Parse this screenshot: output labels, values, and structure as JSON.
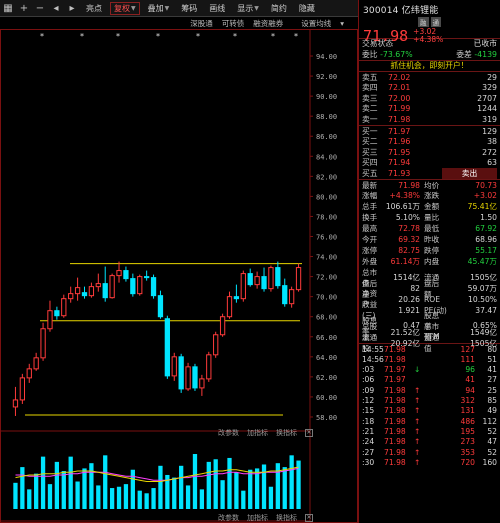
{
  "toolbar": {
    "icons": [
      "grid-icon",
      "plus-icon",
      "minus-icon",
      "arrow-left-icon",
      "arrow-right-icon"
    ],
    "buttons": [
      {
        "label": "亮点",
        "active": false,
        "arrow": false
      },
      {
        "label": "复权",
        "active": true,
        "arrow": true
      },
      {
        "label": "叠加",
        "active": false,
        "arrow": true
      },
      {
        "label": "筹码",
        "active": false,
        "arrow": false
      },
      {
        "label": "画线",
        "active": false,
        "arrow": false
      },
      {
        "label": "显示",
        "active": false,
        "arrow": true
      },
      {
        "label": "简约",
        "active": false,
        "arrow": false
      },
      {
        "label": "隐藏",
        "active": false,
        "arrow": false
      }
    ],
    "sub_items": [
      "深股通",
      "可转债",
      "融资融券",
      "设置均线"
    ],
    "sub_arrow": "▾"
  },
  "main_chart": {
    "y_ticks": [
      "94.00",
      "92.00",
      "90.00",
      "88.00",
      "86.00",
      "84.00",
      "82.00",
      "80.00",
      "78.00",
      "76.00",
      "74.00",
      "72.00",
      "70.00",
      "68.00",
      "66.00",
      "64.00",
      "62.00",
      "60.00",
      "58.00"
    ],
    "ylim": [
      57,
      95
    ],
    "upper_line": 73.3,
    "mid_line": 67.6,
    "lower_line": 58.2,
    "candles": [
      [
        59.0,
        61.0,
        58.1,
        59.7
      ],
      [
        59.7,
        62.3,
        59.3,
        61.9
      ],
      [
        61.9,
        63.3,
        61.4,
        62.8
      ],
      [
        62.8,
        64.4,
        62.6,
        63.9
      ],
      [
        63.9,
        67.4,
        63.6,
        66.8
      ],
      [
        66.8,
        69.6,
        66.5,
        68.6
      ],
      [
        68.6,
        69.0,
        67.7,
        68.1
      ],
      [
        68.1,
        70.2,
        67.9,
        69.8
      ],
      [
        69.8,
        71.0,
        69.4,
        70.3
      ],
      [
        70.3,
        71.9,
        69.6,
        70.9
      ],
      [
        70.4,
        71.0,
        69.8,
        70.1
      ],
      [
        70.1,
        71.4,
        69.9,
        71.0
      ],
      [
        71.0,
        72.3,
        70.5,
        71.3
      ],
      [
        71.3,
        73.0,
        69.5,
        69.9
      ],
      [
        69.9,
        72.3,
        69.8,
        72.1
      ],
      [
        72.1,
        73.5,
        71.4,
        72.6
      ],
      [
        72.6,
        73.0,
        71.5,
        71.8
      ],
      [
        71.8,
        72.3,
        70.0,
        70.3
      ],
      [
        70.3,
        72.2,
        70.1,
        72.0
      ],
      [
        72.0,
        72.6,
        71.6,
        71.9
      ],
      [
        71.9,
        72.2,
        69.8,
        70.1
      ],
      [
        70.1,
        70.6,
        67.8,
        68.0
      ],
      [
        67.8,
        68.1,
        61.8,
        62.1
      ],
      [
        62.1,
        64.4,
        61.6,
        64.0
      ],
      [
        64.0,
        64.3,
        60.4,
        60.8
      ],
      [
        60.8,
        63.4,
        60.6,
        63.0
      ],
      [
        63.0,
        63.3,
        60.6,
        60.9
      ],
      [
        60.9,
        62.2,
        60.1,
        61.8
      ],
      [
        61.8,
        64.5,
        61.5,
        64.2
      ],
      [
        64.2,
        66.5,
        63.9,
        66.2
      ],
      [
        66.2,
        68.3,
        66.0,
        68.0
      ],
      [
        68.0,
        70.5,
        67.8,
        70.0
      ],
      [
        70.0,
        71.2,
        69.4,
        69.8
      ],
      [
        69.8,
        72.6,
        69.5,
        72.3
      ],
      [
        72.3,
        72.8,
        71.0,
        71.2
      ],
      [
        71.2,
        72.5,
        70.8,
        72.0
      ],
      [
        72.0,
        72.9,
        70.5,
        70.8
      ],
      [
        70.8,
        73.1,
        70.5,
        72.9
      ],
      [
        72.9,
        73.5,
        70.8,
        71.1
      ],
      [
        71.1,
        71.8,
        69.0,
        69.3
      ],
      [
        69.3,
        71.0,
        68.9,
        70.7
      ],
      [
        70.7,
        73.3,
        70.5,
        72.9
      ]
    ]
  },
  "indicator1": {
    "tabs": [
      "改参数",
      "加指标",
      "换指标"
    ],
    "bars": [
      2.0,
      3.2,
      1.5,
      2.7,
      4.0,
      1.9,
      3.6,
      2.9,
      4.0,
      2.1,
      3.1,
      3.5,
      1.8,
      4.1,
      1.6,
      1.7,
      1.9,
      3.0,
      1.4,
      1.2,
      1.6,
      3.3,
      2.6,
      2.4,
      3.3,
      1.8,
      4.2,
      1.5,
      3.6,
      3.8,
      2.2,
      3.9,
      2.8,
      1.4,
      3.0,
      3.1,
      3.4,
      1.7,
      3.5,
      3.2,
      4.1,
      3.7
    ],
    "line1": [
      2.6,
      2.6,
      2.5,
      2.5,
      2.5,
      2.5,
      2.6,
      2.6,
      2.7,
      2.7,
      2.8,
      2.8,
      2.8,
      2.8,
      2.7,
      2.6,
      2.5,
      2.5,
      2.4,
      2.3,
      2.2,
      2.2,
      2.2,
      2.3,
      2.4,
      2.4,
      2.5,
      2.5,
      2.6,
      2.7,
      2.7,
      2.8,
      2.8,
      2.7,
      2.7,
      2.7,
      2.8,
      2.8,
      2.8,
      2.9,
      3.0,
      3.1
    ],
    "line2": [
      2.4,
      2.5,
      2.6,
      2.6,
      2.7,
      2.7,
      2.7,
      2.8,
      2.8,
      2.9,
      2.9,
      2.9,
      2.8,
      2.7,
      2.6,
      2.5,
      2.4,
      2.3,
      2.2,
      2.1,
      2.1,
      2.1,
      2.2,
      2.3,
      2.4,
      2.5,
      2.6,
      2.7,
      2.8,
      2.9,
      2.9,
      3.0,
      3.0,
      2.9,
      2.8,
      2.8,
      2.8,
      2.9,
      2.9,
      3.0,
      3.1,
      3.2
    ],
    "ylim": [
      0,
      5.5
    ]
  },
  "indicator2": {
    "tabs": [
      "改参数",
      "加指标",
      "换指标"
    ]
  },
  "quote": {
    "code_name": "300014 亿纬锂能",
    "badges": [
      "融",
      "通"
    ],
    "price": "71.98",
    "change": "+3.02",
    "change_pct": "+4.38%",
    "status_label": "交易状态",
    "status_value": "已收市",
    "wei_bi_label": "委比",
    "wei_bi_value": "-73.67%",
    "wei_cha_label": "委差",
    "wei_cha_value": "-4139",
    "promo": "抓住机会，即刻开户！",
    "asks": [
      {
        "label": "卖五",
        "price": "72.02",
        "vol": "29"
      },
      {
        "label": "卖四",
        "price": "72.01",
        "vol": "329"
      },
      {
        "label": "卖三",
        "price": "72.00",
        "vol": "2707"
      },
      {
        "label": "卖二",
        "price": "71.99",
        "vol": "1244"
      },
      {
        "label": "卖一",
        "price": "71.98",
        "vol": "319"
      }
    ],
    "bids": [
      {
        "label": "买一",
        "price": "71.97",
        "vol": "129"
      },
      {
        "label": "买二",
        "price": "71.96",
        "vol": "38"
      },
      {
        "label": "买三",
        "price": "71.95",
        "vol": "272"
      },
      {
        "label": "买四",
        "price": "71.94",
        "vol": "63"
      },
      {
        "label": "买五",
        "price": "71.93",
        "vol": "卖出"
      }
    ],
    "stats": [
      {
        "l1": "最新",
        "v1": "71.98",
        "c1": "red",
        "l2": "均价",
        "v2": "70.73",
        "c2": "red"
      },
      {
        "l1": "涨幅",
        "v1": "+4.38%",
        "c1": "red",
        "l2": "涨跌",
        "v2": "+3.02",
        "c2": "red"
      },
      {
        "l1": "总手",
        "v1": "106.61万",
        "c1": "white",
        "l2": "金额",
        "v2": "75.41亿",
        "c2": "yellow"
      },
      {
        "l1": "换手",
        "v1": "5.10%",
        "c1": "white",
        "l2": "量比",
        "v2": "1.50",
        "c2": "white"
      },
      {
        "l1": "最高",
        "v1": "72.78",
        "c1": "red",
        "l2": "最低",
        "v2": "67.92",
        "c2": "green"
      },
      {
        "l1": "今开",
        "v1": "69.32",
        "c1": "red",
        "l2": "昨收",
        "v2": "68.96",
        "c2": "white"
      },
      {
        "l1": "涨停",
        "v1": "82.75",
        "c1": "red",
        "l2": "跌停",
        "v2": "55.17",
        "c2": "green"
      },
      {
        "l1": "外盘",
        "v1": "61.14万",
        "c1": "red",
        "l2": "内盘",
        "v2": "45.47万",
        "c2": "green"
      },
      {
        "l1": "总市值",
        "v1": "1514亿",
        "c1": "white",
        "l2": "流通",
        "v2": "1505亿",
        "c2": "white"
      }
    ],
    "stats_b": [
      {
        "l1": "盘后量",
        "v1": "82",
        "c1": "white",
        "l2": "盘后额",
        "v2": "59.07万",
        "c2": "white"
      },
      {
        "l1": "净资产",
        "v1": "20.26",
        "c1": "white",
        "l2": "ROE",
        "v2": "10.50%",
        "c2": "white"
      },
      {
        "l1": "收益(三)",
        "v1": "1.921",
        "c1": "white",
        "l2": "PE(动)",
        "v2": "37.47",
        "c2": "white"
      },
      {
        "l1": "股息率",
        "v1": "0.47",
        "c1": "white",
        "l2": "股息率TTM",
        "v2": "0.65%",
        "c2": "white"
      },
      {
        "l1": "总股本",
        "v1": "21.52亿",
        "c1": "white",
        "l2": "总市值",
        "v2": "1549亿",
        "c2": "white"
      },
      {
        "l1": "流通股",
        "v1": "20.92亿",
        "c1": "white",
        "l2": "流通值",
        "v2": "1505亿",
        "c2": "white"
      }
    ],
    "ticks": [
      {
        "t": "14:55",
        "p": "71.98",
        "a": "",
        "q": "127",
        "n": "80"
      },
      {
        "t": "14:56",
        "p": "71.98",
        "a": "",
        "q": "111",
        "n": "51"
      },
      {
        "t": ":03",
        "p": "71.97",
        "a": "↓",
        "q": "96",
        "n": "41"
      },
      {
        "t": ":06",
        "p": "71.97",
        "a": "",
        "q": "41",
        "n": "27"
      },
      {
        "t": ":09",
        "p": "71.98",
        "a": "↑",
        "q": "94",
        "n": "25"
      },
      {
        "t": ":12",
        "p": "71.98",
        "a": "↑",
        "q": "312",
        "n": "85"
      },
      {
        "t": ":15",
        "p": "71.98",
        "a": "↑",
        "q": "131",
        "n": "49"
      },
      {
        "t": ":18",
        "p": "71.98",
        "a": "↑",
        "q": "486",
        "n": "112"
      },
      {
        "t": ":21",
        "p": "71.98",
        "a": "↑",
        "q": "195",
        "n": "52"
      },
      {
        "t": ":24",
        "p": "71.98",
        "a": "↑",
        "q": "273",
        "n": "47"
      },
      {
        "t": ":27",
        "p": "71.98",
        "a": "↑",
        "q": "353",
        "n": "52"
      },
      {
        "t": ":30",
        "p": "71.98",
        "a": "↑",
        "q": "720",
        "n": "160"
      }
    ],
    "colors": {
      "up": "#ff3b3b",
      "down": "#22d13f",
      "cyan": "#00e5ff",
      "yellow": "#e8d600"
    }
  }
}
